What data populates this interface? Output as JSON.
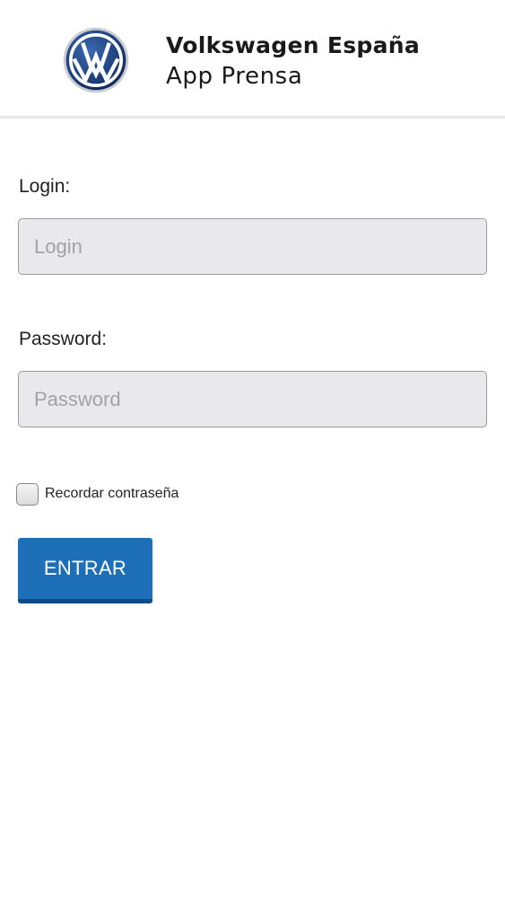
{
  "header": {
    "logo_icon": "vw-logo-icon",
    "title": "Volkswagen España",
    "subtitle": "App Prensa"
  },
  "form": {
    "login_label": "Login:",
    "login_placeholder": "Login",
    "login_value": "",
    "password_label": "Password:",
    "password_placeholder": "Password",
    "password_value": "",
    "remember_label": "Recordar contraseña",
    "remember_checked": false,
    "submit_label": "ENTRAR"
  },
  "colors": {
    "accent": "#1d6fb8",
    "accent_dark": "#0f4a84",
    "field_bg": "#e9e8ea",
    "logo_blue": "#1e3f7a"
  }
}
